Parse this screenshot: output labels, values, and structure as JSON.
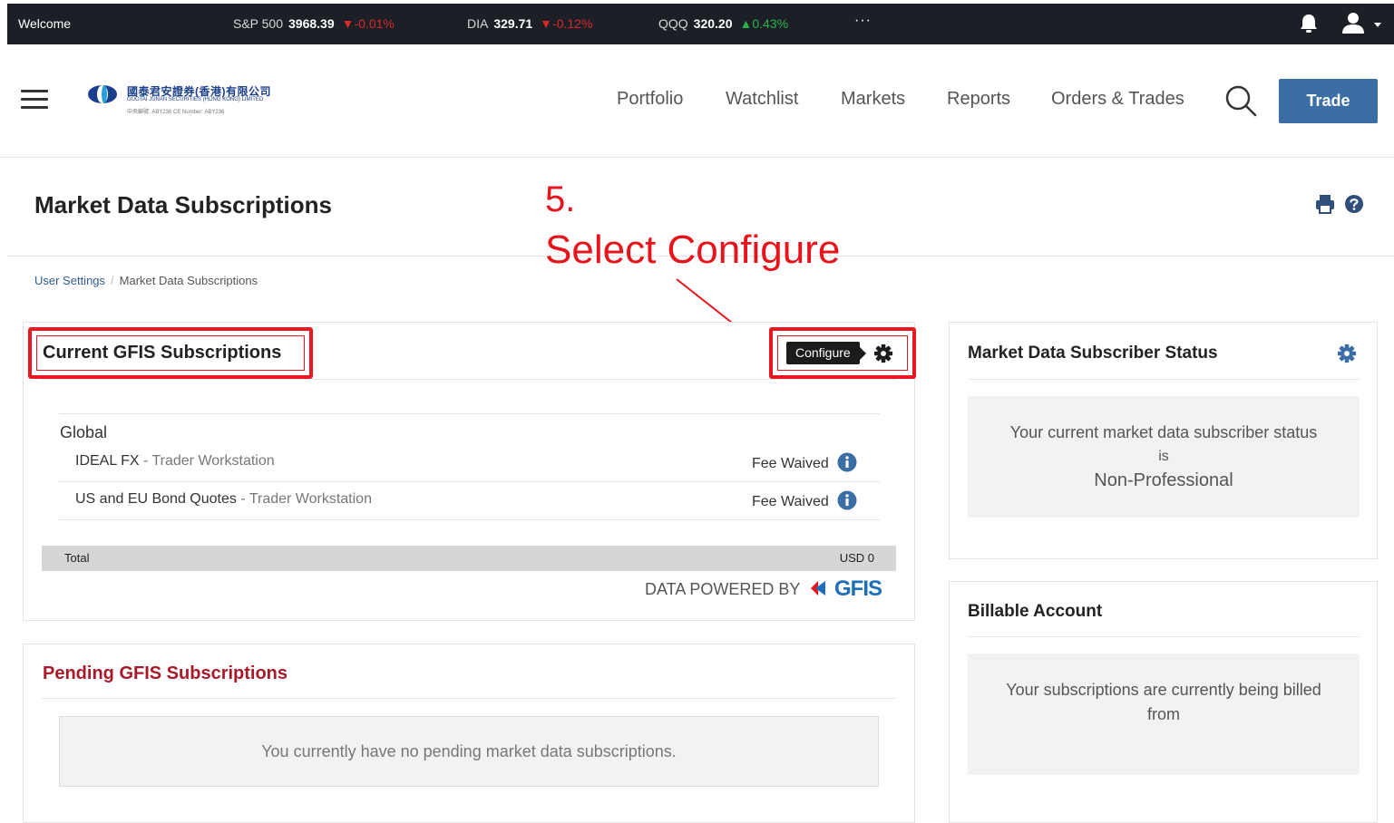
{
  "ticker": {
    "welcome": "Welcome",
    "items": [
      {
        "symbol": "S&P 500",
        "price": "3968.39",
        "change": "▼-0.01%",
        "direction": "down"
      },
      {
        "symbol": "DIA",
        "price": "329.71",
        "change": "▼-0.12%",
        "direction": "down"
      },
      {
        "symbol": "QQQ",
        "price": "320.20",
        "change": "▲0.43%",
        "direction": "up"
      }
    ],
    "more": "···",
    "colors": {
      "down": "#d9272e",
      "up": "#29b34a"
    }
  },
  "header": {
    "logo": {
      "name_cn": "國泰君安證券(香港)有限公司",
      "name_en": "GUOTAI JUNAN SECURITIES (HONG KONG) LIMITED",
      "ce_number": "中央編號: ABY236  CE Number: ABY236"
    },
    "nav": [
      "Portfolio",
      "Watchlist",
      "Markets",
      "Reports",
      "Orders & Trades"
    ],
    "trade_label": "Trade",
    "brand_color": "#3a6ea5"
  },
  "page": {
    "title": "Market Data Subscriptions",
    "breadcrumb": [
      "User Settings",
      "Market Data Subscriptions"
    ]
  },
  "annotation": {
    "step": "5.",
    "text": "Select Configure",
    "color": "#e8141c"
  },
  "current": {
    "title": "Current GFIS Subscriptions",
    "configure_label": "Configure",
    "group": "Global",
    "rows": [
      {
        "name": "IDEAL FX",
        "platform": " - Trader Workstation",
        "fee": "Fee Waived"
      },
      {
        "name": "US and EU Bond Quotes",
        "platform": " - Trader Workstation",
        "fee": "Fee Waived"
      }
    ],
    "total_label": "Total",
    "total_value": "USD 0",
    "powered_by": "DATA POWERED BY",
    "gfis": "GFIS"
  },
  "pending": {
    "title": "Pending GFIS Subscriptions",
    "empty_msg": "You currently have no pending market data subscriptions."
  },
  "status": {
    "title": "Market Data Subscriber Status",
    "line1": "Your current market data subscriber status",
    "line2": "is",
    "value": "Non-Professional"
  },
  "billable": {
    "title": "Billable Account",
    "line1": "Your subscriptions are currently being billed",
    "line2": "from"
  }
}
